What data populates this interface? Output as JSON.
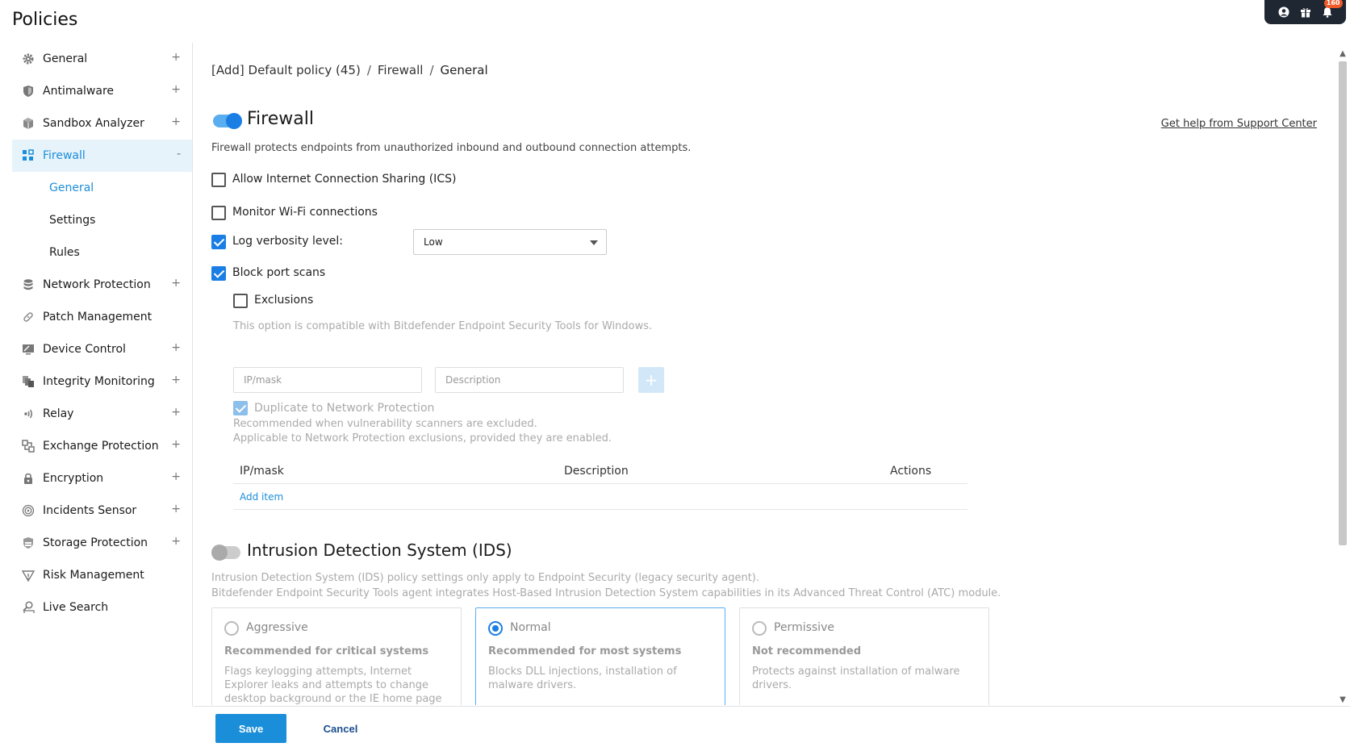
{
  "page": {
    "title": "Policies"
  },
  "topbar": {
    "notification_count": "160"
  },
  "sidebar": {
    "items": [
      {
        "label": "General",
        "icon": "gear-icon",
        "expandable": "+"
      },
      {
        "label": "Antimalware",
        "icon": "shield-icon",
        "expandable": "+"
      },
      {
        "label": "Sandbox Analyzer",
        "icon": "cube-icon",
        "expandable": "+"
      },
      {
        "label": "Firewall",
        "icon": "firewall-icon",
        "expandable": "-"
      },
      {
        "label": "Network Protection",
        "icon": "database-icon",
        "expandable": "+"
      },
      {
        "label": "Patch Management",
        "icon": "bandage-icon",
        "expandable": ""
      },
      {
        "label": "Device Control",
        "icon": "monitor-icon",
        "expandable": "+"
      },
      {
        "label": "Integrity Monitoring",
        "icon": "files-icon",
        "expandable": "+"
      },
      {
        "label": "Relay",
        "icon": "relay-icon",
        "expandable": "+"
      },
      {
        "label": "Exchange Protection",
        "icon": "exchange-icon",
        "expandable": "+"
      },
      {
        "label": "Encryption",
        "icon": "lock-icon",
        "expandable": "+"
      },
      {
        "label": "Incidents Sensor",
        "icon": "sensor-icon",
        "expandable": "+"
      },
      {
        "label": "Storage Protection",
        "icon": "storage-icon",
        "expandable": "+"
      },
      {
        "label": "Risk Management",
        "icon": "risk-icon",
        "expandable": ""
      },
      {
        "label": "Live Search",
        "icon": "search-person-icon",
        "expandable": ""
      }
    ],
    "firewall_sub": [
      {
        "label": "General"
      },
      {
        "label": "Settings"
      },
      {
        "label": "Rules"
      }
    ]
  },
  "breadcrumb": {
    "part1": "[Add] Default policy (45)",
    "part2": "Firewall",
    "part3": "General",
    "sep": "/"
  },
  "firewall": {
    "title": "Firewall",
    "enabled": true,
    "help_link": "Get help from Support Center",
    "description": "Firewall protects endpoints from unauthorized inbound and outbound connection attempts.",
    "ics_label": "Allow Internet Connection Sharing (ICS)",
    "wifi_label": "Monitor Wi-Fi connections",
    "log_label": "Log verbosity level:",
    "log_value": "Low",
    "portscan_label": "Block port scans",
    "exclusions_label": "Exclusions",
    "compat_note": "This option is compatible with Bitdefender Endpoint Security Tools for Windows.",
    "ipmask_placeholder": "IP/mask",
    "description_placeholder": "Description",
    "add_symbol": "+",
    "duplicate_label": "Duplicate to Network Protection",
    "duplicate_note1": "Recommended when vulnerability scanners are excluded.",
    "duplicate_note2": "Applicable to Network Protection exclusions, provided they are enabled.",
    "table": {
      "col_ipmask": "IP/mask",
      "col_description": "Description",
      "col_actions": "Actions",
      "add_item": "Add item"
    }
  },
  "ids": {
    "title": "Intrusion Detection System (IDS)",
    "enabled": false,
    "note1": "Intrusion Detection System (IDS) policy settings only apply to Endpoint Security (legacy security agent).",
    "note2": "Bitdefender Endpoint Security Tools agent integrates Host-Based Intrusion Detection System capabilities in its Advanced Threat Control (ATC) module.",
    "levels": [
      {
        "label": "Aggressive",
        "subtitle": "Recommended for critical systems",
        "desc": "Flags keylogging attempts, Internet Explorer leaks and attempts to change desktop background or the IE home page"
      },
      {
        "label": "Normal",
        "subtitle": "Recommended for most systems",
        "desc": "Blocks DLL injections, installation of malware drivers."
      },
      {
        "label": "Permissive",
        "subtitle": "Not recommended",
        "desc": "Protects against installation of malware drivers."
      }
    ]
  },
  "footer": {
    "save": "Save",
    "cancel": "Cancel"
  }
}
